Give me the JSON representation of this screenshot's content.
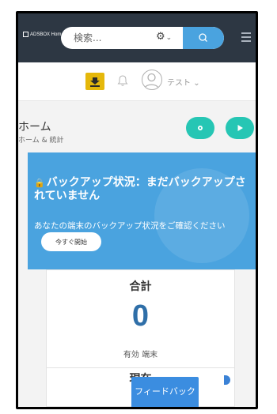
{
  "topnav": {
    "brand": "ADSBOX Hom",
    "search_placeholder": "検索...",
    "search_settings_icon": "gear-icon",
    "search_icon": "search-icon",
    "menu_icon": "hamburger-icon"
  },
  "subbar": {
    "download_icon": "download-icon",
    "bell_icon": "bell-icon",
    "avatar_icon": "user-avatar-icon",
    "user_name": "テスト",
    "user_caret": "⌄"
  },
  "page": {
    "title": "ホーム",
    "breadcrumb": "ホーム & 統計"
  },
  "backup": {
    "heading": "バックアップ状況：まだバックアップされていません",
    "subtext": "あなたの端末のバックアップ状況をご確認ください",
    "start_button": "今すぐ開始"
  },
  "stats": {
    "title": "合計",
    "value": "0",
    "label": "有効 端末"
  },
  "current": {
    "title": "現在"
  },
  "feedback": {
    "label": "フィードバック"
  },
  "colors": {
    "nav_bg": "#2d3743",
    "accent_blue": "#4aa3df",
    "teal": "#26c6b4",
    "download_yellow": "#e5b80b",
    "value_blue": "#2f6fa8"
  }
}
